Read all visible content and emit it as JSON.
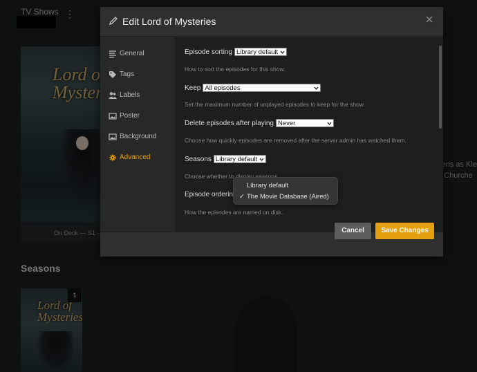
{
  "background": {
    "section_title": "TV Shows",
    "poster_title": "Lord of Mysteries",
    "on_deck": "On Deck — S1 ·",
    "seasons_heading": "Seasons",
    "season_badge": "1",
    "side_text_line1": "kens as Kle",
    "side_text_line2": "g Churche"
  },
  "modal": {
    "title": "Edit Lord of Mysteries",
    "sidebar": [
      {
        "label": "General",
        "icon": "list-icon"
      },
      {
        "label": "Tags",
        "icon": "tag-icon"
      },
      {
        "label": "Labels",
        "icon": "users-icon"
      },
      {
        "label": "Poster",
        "icon": "image-icon"
      },
      {
        "label": "Background",
        "icon": "image-icon"
      },
      {
        "label": "Advanced",
        "icon": "gear-icon",
        "active": true
      }
    ],
    "settings": {
      "episode_sorting": {
        "label": "Episode sorting",
        "value": "Library default",
        "help": "How to sort the episodes for this show."
      },
      "keep": {
        "label": "Keep",
        "value": "All episodes",
        "help": "Set the maximum number of unplayed episodes to keep for the show."
      },
      "delete_after": {
        "label": "Delete episodes after playing",
        "value": "Never",
        "help": "Choose how quickly episodes are removed after the server admin has watched them."
      },
      "seasons": {
        "label": "Seasons",
        "value": "Library default",
        "help": "Choose whether to display seasons."
      },
      "episode_ordering": {
        "label": "Episode ordering",
        "help": "How the episodes are named on disk."
      }
    },
    "dropdown": {
      "options": [
        "Library default",
        "The Movie Database (Aired)"
      ],
      "checked_mark": "✓"
    },
    "buttons": {
      "cancel": "Cancel",
      "save": "Save Changes"
    }
  },
  "colors": {
    "accent": "#e5a00d",
    "modal_bg": "#282828",
    "content_bg": "#1d1e1e"
  }
}
